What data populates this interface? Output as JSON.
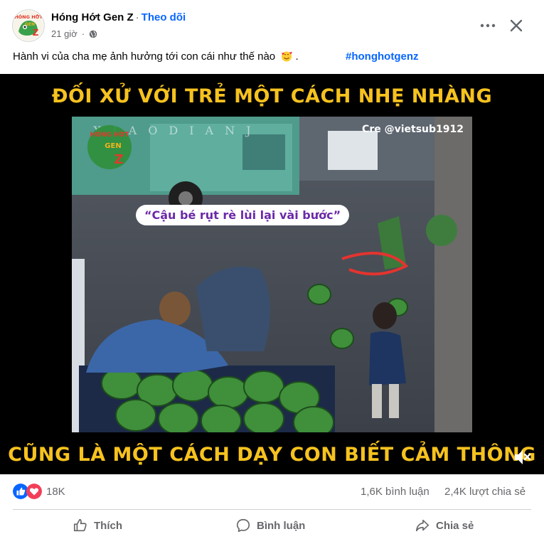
{
  "post": {
    "author": "Hóng Hớt Gen Z",
    "separator": "·",
    "follow_label": "Theo dõi",
    "time": "21 giờ",
    "time_separator": "·",
    "privacy_icon": "globe-icon",
    "caption": "Hành vi của cha mẹ ảnh hưởng tới con cái như thế nào",
    "caption_emoji": "smiling-face-with-hearts-emoji",
    "caption_end": ".",
    "hashtag": "#honghotgenz"
  },
  "avatar": {
    "line1": "HÓNG HỚT",
    "line2": "GEN",
    "line3": "Z"
  },
  "video": {
    "headline": "ĐỐI XỬ VỚI TRẺ MỘT CÁCH NHẸ NHÀNG",
    "footline": "CŨNG LÀ MỘT CÁCH DẠY CON BIẾT CẢM THÔNG",
    "watermark": "XIAODIANJ",
    "credit": "Cre @vietsub1912",
    "speech": "“Cậu bé rụt rè lùi lại vài bước”",
    "overlay_logo": {
      "line1": "HÓNG HỚT",
      "line2": "GEN",
      "line3": "Z"
    },
    "mute_icon": "speaker-muted-icon"
  },
  "stats": {
    "reaction_icons": [
      "like-icon",
      "love-icon"
    ],
    "reactions": "18K",
    "comments": "1,6K bình luận",
    "shares": "2,4K lượt chia sẻ"
  },
  "actions": {
    "like": "Thích",
    "comment": "Bình luận",
    "share": "Chia sẻ"
  },
  "colors": {
    "accent": "#0866ff",
    "caption_text": "#f6c21e",
    "speech_text": "#6b2aa8",
    "love": "#f33e58"
  }
}
